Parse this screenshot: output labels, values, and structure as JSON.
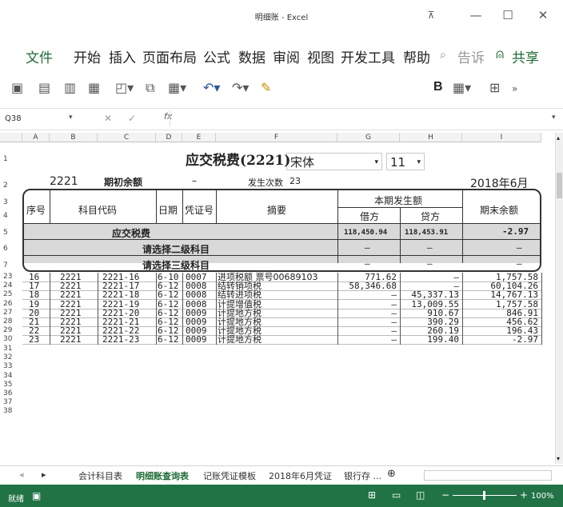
{
  "window": {
    "title": "明细账 - Excel",
    "min": "—",
    "max": "☐",
    "close": "✕",
    "ribbon_opts": "⊼"
  },
  "ribbon": {
    "tabs": [
      "文件",
      "开始",
      "插入",
      "页面布局",
      "公式",
      "数据",
      "审阅",
      "视图",
      "开发工具",
      "帮助",
      "告诉",
      "共享"
    ],
    "tell_icon": "search-icon",
    "share_icon": "person-icon"
  },
  "toolbar": {
    "font": "宋体",
    "size": "11",
    "bold": "B"
  },
  "formula_bar": {
    "cell_ref": "Q38",
    "fx": "fx",
    "value": ""
  },
  "columns": [
    "A",
    "B",
    "C",
    "D",
    "E",
    "F",
    "G",
    "H",
    "I"
  ],
  "sheet": {
    "title": "应交税费(2221)",
    "code": "2221",
    "opening_label": "期初余额",
    "opening_value": "–",
    "count_label": "发生次数",
    "count_value": "23",
    "period": "2018年6月",
    "headers": {
      "seq": "序号",
      "account_code": "科目代码",
      "date": "日期",
      "voucher": "凭证号",
      "summary": "摘要",
      "period_amount": "本期发生额",
      "debit": "借方",
      "credit": "贷方",
      "closing": "期末余额"
    },
    "summary_row": {
      "label": "应交税费",
      "debit": "118,450.94",
      "credit": "118,453.91",
      "closing": "-2.97"
    },
    "level2_row": {
      "label": "请选择二级科目",
      "debit": "–",
      "credit": "–",
      "closing": "–"
    },
    "level3_row": {
      "label": "请选择三级科目",
      "debit": "–",
      "credit": "–",
      "closing": "–"
    },
    "header_row_numbers": [
      "1",
      "2",
      "3",
      "4",
      "5",
      "6",
      "7"
    ],
    "rows": [
      {
        "rownum": "23",
        "seq": "16",
        "code": "2221",
        "subcode": "2221-16",
        "date": "6-10",
        "voucher": "0007",
        "summary": "进项税额 票号00689103",
        "debit": "771.62",
        "credit": "–",
        "closing": "1,757.58"
      },
      {
        "rownum": "24",
        "seq": "17",
        "code": "2221",
        "subcode": "2221-17",
        "date": "6-12",
        "voucher": "0008",
        "summary": "结转销项税",
        "debit": "58,346.68",
        "credit": "–",
        "closing": "60,104.26"
      },
      {
        "rownum": "25",
        "seq": "18",
        "code": "2221",
        "subcode": "2221-18",
        "date": "6-12",
        "voucher": "0008",
        "summary": "结转进项税",
        "debit": "–",
        "credit": "45,337.13",
        "closing": "14,767.13"
      },
      {
        "rownum": "26",
        "seq": "19",
        "code": "2221",
        "subcode": "2221-19",
        "date": "6-12",
        "voucher": "0008",
        "summary": "计提增值税",
        "debit": "–",
        "credit": "13,009.55",
        "closing": "1,757.58"
      },
      {
        "rownum": "27",
        "seq": "20",
        "code": "2221",
        "subcode": "2221-20",
        "date": "6-12",
        "voucher": "0009",
        "summary": "计提地方税",
        "debit": "–",
        "credit": "910.67",
        "closing": "846.91"
      },
      {
        "rownum": "28",
        "seq": "21",
        "code": "2221",
        "subcode": "2221-21",
        "date": "6-12",
        "voucher": "0009",
        "summary": "计提地方税",
        "debit": "–",
        "credit": "390.29",
        "closing": "456.62"
      },
      {
        "rownum": "29",
        "seq": "22",
        "code": "2221",
        "subcode": "2221-22",
        "date": "6-12",
        "voucher": "0009",
        "summary": "计提地方税",
        "debit": "–",
        "credit": "260.19",
        "closing": "196.43"
      },
      {
        "rownum": "30",
        "seq": "23",
        "code": "2221",
        "subcode": "2221-23",
        "date": "6-12",
        "voucher": "0009",
        "summary": "计提地方税",
        "debit": "–",
        "credit": "199.40",
        "closing": "-2.97"
      }
    ],
    "empty_rownums": [
      "31",
      "32",
      "33",
      "34",
      "35",
      "36",
      "37",
      "38"
    ]
  },
  "sheet_tabs": [
    "会计科目表",
    "明细账查询表",
    "记账凭证模板",
    "2018年6月凭证",
    "银行存 ..."
  ],
  "active_tab": "明细账查询表",
  "status": {
    "ready": "就绪",
    "zoom": "100%"
  },
  "colors": {
    "excel_green": "#217346",
    "header_gray": "#d9d9d9"
  }
}
